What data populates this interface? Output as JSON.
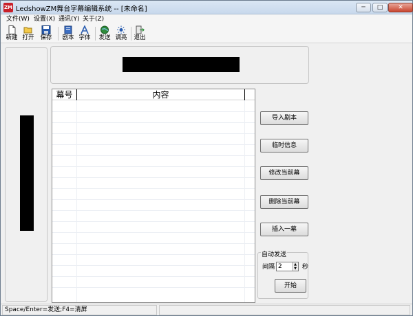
{
  "window": {
    "title": "LedshowZM舞台字幕编辑系统 -- [未命名]",
    "app_icon_text": "ZM",
    "minimize_label": "─",
    "maximize_label": "□",
    "close_label": "✕"
  },
  "menu": {
    "items": [
      {
        "label": "文件(W)"
      },
      {
        "label": "设置(X)"
      },
      {
        "label": "通讯(Y)"
      },
      {
        "label": "关于(Z)"
      }
    ]
  },
  "toolbar": {
    "new_label": "新建",
    "open_label": "打开",
    "save_label": "保存",
    "script_label": "剧本",
    "font_label": "字体",
    "send_label": "发送",
    "brightness_label": "调亮",
    "exit_label": "退出"
  },
  "list": {
    "col_number": "幕号",
    "col_content": "内容"
  },
  "side_buttons": {
    "import_script": "导入剧本",
    "temp_info": "临时信息",
    "modify_current": "修改当前幕",
    "delete_current": "删除当前幕",
    "insert_one": "插入一幕"
  },
  "auto_send": {
    "title": "自动发送",
    "interval_label": "间隔",
    "interval_value": "2",
    "seconds_label": "秒",
    "start_label": "开始"
  },
  "statusbar": {
    "hint": "Space/Enter=发送;F4=清屏"
  },
  "colors": {
    "accent_red": "#c8202a",
    "window_bg": "#f0f0f0"
  }
}
